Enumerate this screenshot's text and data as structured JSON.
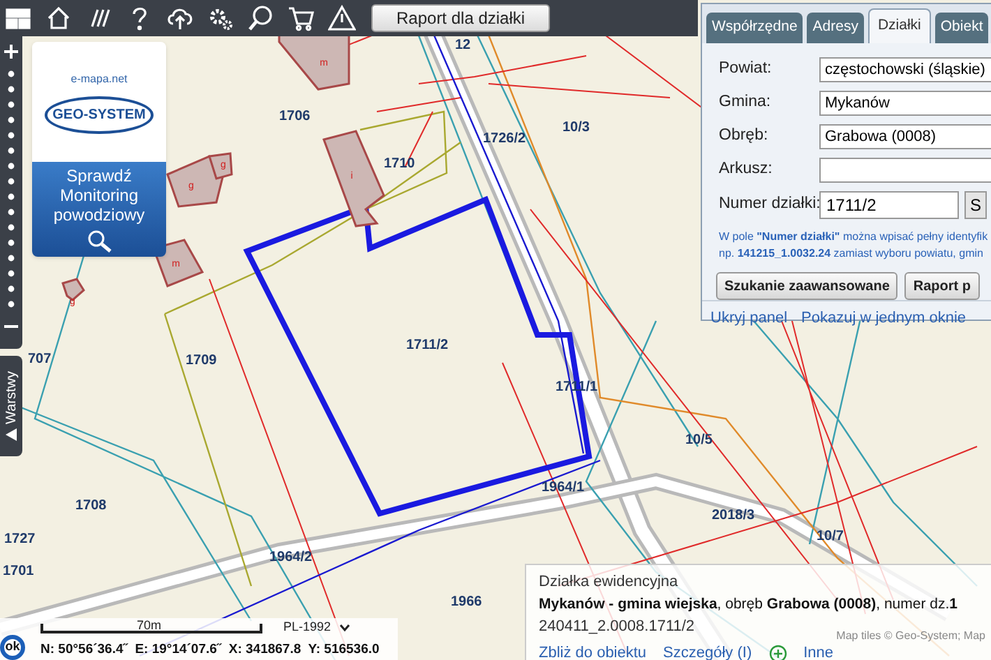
{
  "toolbar": {
    "report_button": "Raport dla działki"
  },
  "promo": {
    "site": "e-mapa.net",
    "logo": "GEO-SYSTEM",
    "lines": [
      "Sprawdź",
      "Monitoring",
      "powodziowy"
    ]
  },
  "layers_tab": {
    "label": "Warstwy"
  },
  "map": {
    "parcel_labels": [
      "12",
      "1706",
      "1726/2",
      "10/3",
      "1710",
      "1711/2",
      "707",
      "1709",
      "1711/1",
      "10/5",
      "1708",
      "1964/1",
      "1964/2",
      "2018/3",
      "10/7",
      "1727",
      "1701",
      "1966"
    ],
    "buildings": [
      {
        "label": "m"
      },
      {
        "label": "g"
      },
      {
        "label": "g"
      },
      {
        "label": "i"
      },
      {
        "label": "m"
      },
      {
        "label": "g"
      }
    ]
  },
  "search_panel": {
    "tabs": [
      {
        "label": "Współrzędne",
        "selected": false
      },
      {
        "label": "Adresy",
        "selected": false
      },
      {
        "label": "Działki",
        "selected": true
      },
      {
        "label": "Obiekt",
        "selected": false
      }
    ],
    "fields": [
      {
        "kind": "select",
        "label": "Powiat:",
        "value": "częstochowski (śląskie)"
      },
      {
        "kind": "select",
        "label": "Gmina:",
        "value": "Mykanów"
      },
      {
        "kind": "select",
        "label": "Obręb:",
        "value": "Grabowa (0008)"
      },
      {
        "kind": "text",
        "label": "Arkusz:"
      },
      {
        "kind": "search",
        "label": "Numer działki:",
        "value": "1711/2",
        "button": "S"
      }
    ],
    "hint": [
      "W pole **\"Numer działki\"** można wpisać pełny identyfik",
      "np. **141215_1.0032.24** zamiast wyboru powiatu, gmin"
    ],
    "buttons": [
      "Szukanie zaawansowane",
      "Raport p"
    ],
    "links": [
      "Ukryj panel",
      "Pokazuj w jednym oknie"
    ]
  },
  "info_box": {
    "title": "Działka ewidencyjna",
    "description": "**Mykanów - gmina wiejska**, obręb **Grabowa (0008)**, numer dz.**1**",
    "identifier": "240411_2.0008.1711/2",
    "links": [
      "Zbliż do obiektu",
      "Szczegóły (I)",
      "Inne"
    ],
    "attribution": "Map tiles © Geo-System; Map"
  },
  "scale": {
    "label": "70m",
    "projection": "PL-1992"
  },
  "coordinates": {
    "ok_button": "ok",
    "text": "N: 50°56´36.4˝  E: 19°14´07.6˝  X: 341867.8  Y: 516536.0"
  }
}
